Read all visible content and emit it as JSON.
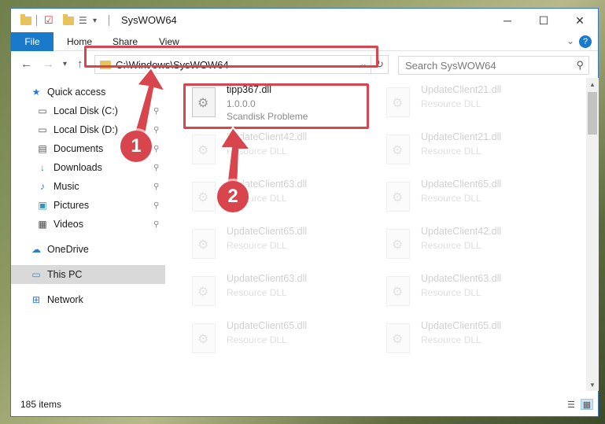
{
  "window": {
    "title": "SysWOW64",
    "controls": {
      "minimize": "─",
      "maximize": "☐",
      "close": "✕"
    }
  },
  "quick_access_toolbar": {
    "customize_icon": "▾"
  },
  "ribbon": {
    "tabs": [
      "File",
      "Home",
      "Share",
      "View"
    ],
    "expand_icon": "⌄",
    "help_icon": "?"
  },
  "nav": {
    "back": "←",
    "forward": "→",
    "recent": "▾",
    "up": "↑",
    "address": "C:\\Windows\\SysWOW64",
    "address_dropdown": "⌄",
    "refresh": "↻",
    "search_placeholder": "Search SysWOW64",
    "search_icon": "⚲"
  },
  "sidebar": {
    "items": [
      {
        "label": "Quick access",
        "icon": "star-icon",
        "glyph": "★",
        "color": "#2b7bd3",
        "pinned": false
      },
      {
        "label": "Local Disk (C:)",
        "icon": "drive-icon",
        "glyph": "▭",
        "color": "#555555",
        "pinned": true
      },
      {
        "label": "Local Disk (D:)",
        "icon": "drive-icon",
        "glyph": "▭",
        "color": "#555555",
        "pinned": true
      },
      {
        "label": "Documents",
        "icon": "document-icon",
        "glyph": "▤",
        "color": "#555555",
        "pinned": true
      },
      {
        "label": "Downloads",
        "icon": "download-icon",
        "glyph": "↓",
        "color": "#2b7bd3",
        "pinned": true
      },
      {
        "label": "Music",
        "icon": "music-icon",
        "glyph": "♪",
        "color": "#2b7bd3",
        "pinned": true
      },
      {
        "label": "Pictures",
        "icon": "pictures-icon",
        "glyph": "▣",
        "color": "#3a8ec9",
        "pinned": true
      },
      {
        "label": "Videos",
        "icon": "video-icon",
        "glyph": "▦",
        "color": "#444444",
        "pinned": true
      },
      {
        "label": "OneDrive",
        "icon": "cloud-icon",
        "glyph": "☁",
        "color": "#2b7bd3",
        "pinned": false
      },
      {
        "label": "This PC",
        "icon": "computer-icon",
        "glyph": "▭",
        "color": "#3a8ec9",
        "pinned": false,
        "selected": true
      },
      {
        "label": "Network",
        "icon": "network-icon",
        "glyph": "⊞",
        "color": "#2b7bd3",
        "pinned": false
      }
    ],
    "pin_glyph": "⚲"
  },
  "files": [
    {
      "name": "tipp367.dll",
      "line2": "1.0.0.0",
      "line3": "Scandisk Probleme",
      "highlight": true
    },
    {
      "name": "UpdateClient21.dll",
      "line2": "Resource DLL"
    },
    {
      "name": "UpdateClient42.dll",
      "line2": "Resource DLL"
    },
    {
      "name": "UpdateClient21.dll",
      "line2": "Resource DLL"
    },
    {
      "name": "UpdateClient63.dll",
      "line2": "Resource DLL"
    },
    {
      "name": "UpdateClient65.dll",
      "line2": "Resource DLL"
    },
    {
      "name": "UpdateClient65.dll",
      "line2": "Resource DLL"
    },
    {
      "name": "UpdateClient42.dll",
      "line2": "Resource DLL"
    },
    {
      "name": "UpdateClient63.dll",
      "line2": "Resource DLL"
    },
    {
      "name": "UpdateClient63.dll",
      "line2": "Resource DLL"
    },
    {
      "name": "UpdateClient65.dll",
      "line2": "Resource DLL"
    },
    {
      "name": "UpdateClient65.dll",
      "line2": "Resource DLL"
    }
  ],
  "status": {
    "item_count": "185 items",
    "details_view_icon": "☰",
    "tiles_view_icon": "▦"
  },
  "annotations": {
    "marker1": "1",
    "marker2": "2",
    "color": "#d9454c"
  }
}
